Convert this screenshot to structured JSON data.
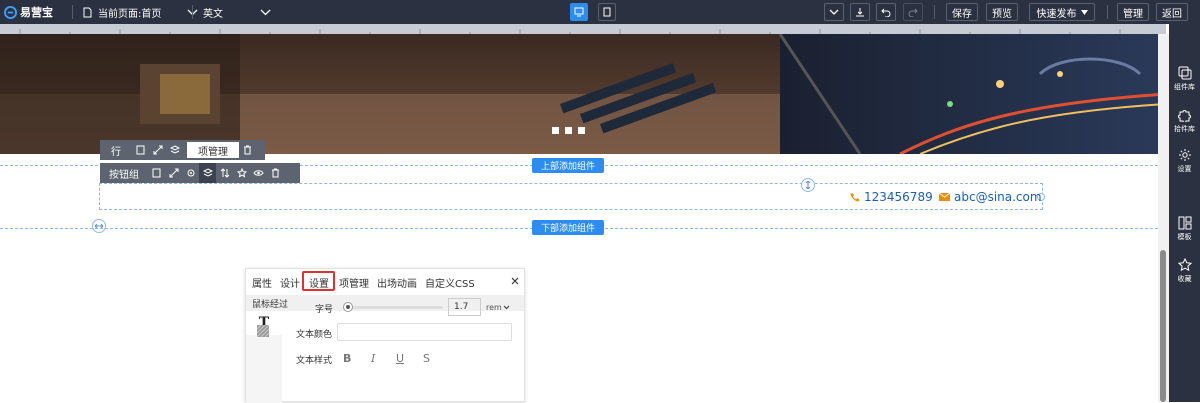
{
  "topbar": {
    "logo_text": "易营宝",
    "current_page_label": "当前页面:首页",
    "language": "英文",
    "save": "保存",
    "preview": "预览",
    "quick_publish": "快速发布",
    "manage": "管理",
    "back": "返回"
  },
  "sidebar": {
    "items": [
      {
        "label": "组件库",
        "icon": "layers-copy-icon"
      },
      {
        "label": "拾件库",
        "icon": "puzzle-icon"
      },
      {
        "label": "设置",
        "icon": "gear-icon"
      },
      {
        "label": "模板",
        "icon": "template-icon"
      },
      {
        "label": "收藏",
        "icon": "star-icon"
      }
    ]
  },
  "row_toolbar": {
    "label": "行",
    "item_manage": "项管理"
  },
  "button_group_toolbar": {
    "label": "按钮组"
  },
  "add_above": "上部添加组件",
  "add_below": "下部添加组件",
  "contact": {
    "phone": "123456789",
    "email": "abc@sina.com"
  },
  "panel": {
    "tabs": [
      "属性",
      "设计",
      "设置",
      "项管理",
      "出场动画",
      "自定义CSS"
    ],
    "active_tab": "设置",
    "subtab": "鼠标经过",
    "font_size_label": "字号",
    "font_size_value": "1.7",
    "font_size_unit": "rem",
    "text_color_label": "文本颜色",
    "text_style_label": "文本样式",
    "styles": [
      "B",
      "I",
      "U",
      "S"
    ]
  },
  "colors": {
    "accent": "#2d8cf0",
    "topbar_bg": "#2b3140",
    "highlight": "#e03131"
  }
}
